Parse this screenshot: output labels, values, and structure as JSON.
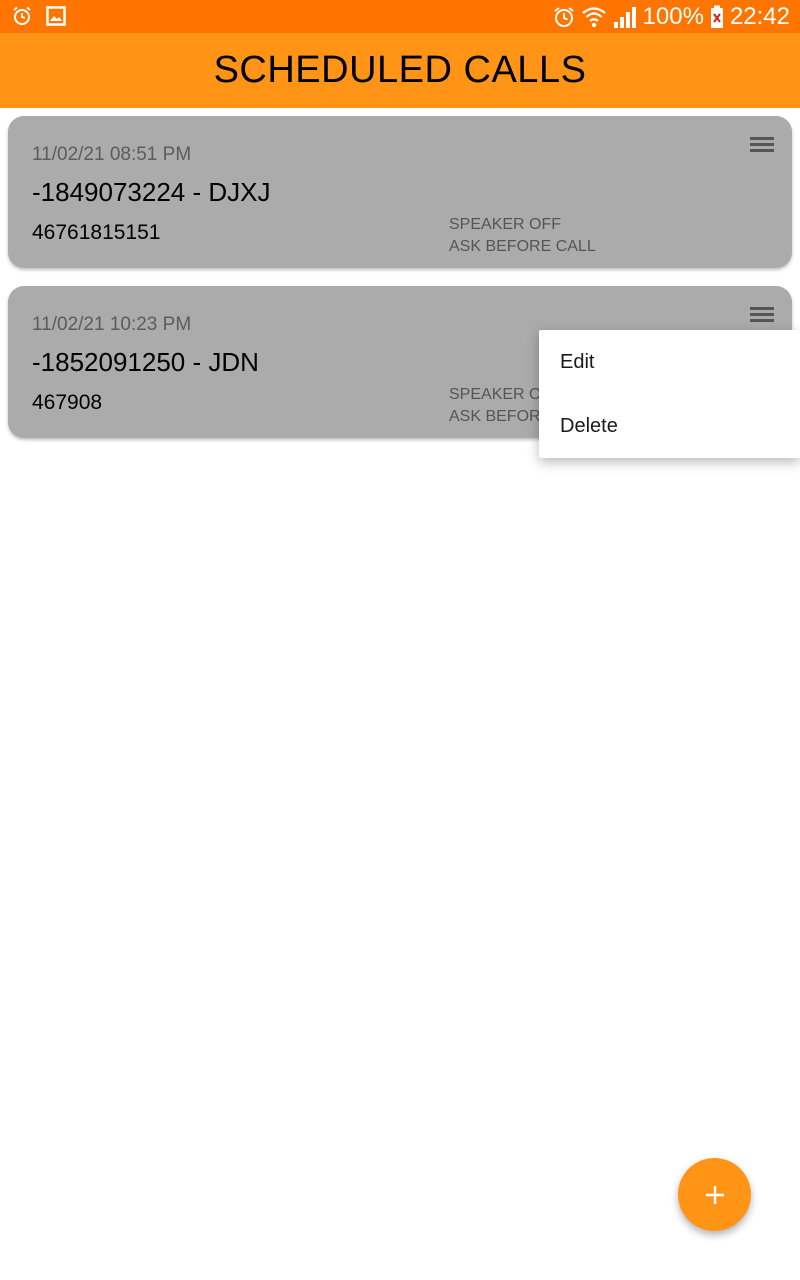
{
  "status_bar": {
    "left_icons": [
      "alarm-icon",
      "image-icon"
    ],
    "right_icons": [
      "alarm-icon",
      "wifi-icon",
      "signal-icon",
      "battery-icon"
    ],
    "battery": "100%",
    "time": "22:42"
  },
  "app_bar": {
    "title": "SCHEDULED CALLS"
  },
  "calls": [
    {
      "date": "11/02/21 08:51 PM",
      "title": "-1849073224 - DJXJ",
      "number": "46761815151",
      "speaker": "SPEAKER OFF",
      "ask": "ASK BEFORE CALL"
    },
    {
      "date": "11/02/21 10:23 PM",
      "title": "-1852091250 - JDN",
      "number": "467908",
      "speaker": "SPEAKER ON",
      "ask": "ASK BEFORE CALL"
    }
  ],
  "popup_menu": {
    "items": [
      "Edit",
      "Delete"
    ]
  },
  "fab": {
    "icon": "plus-icon"
  },
  "colors": {
    "status_bar": "#ff7500",
    "app_bar": "#ff9417",
    "card": "#ababab",
    "fab": "#ff9417"
  }
}
